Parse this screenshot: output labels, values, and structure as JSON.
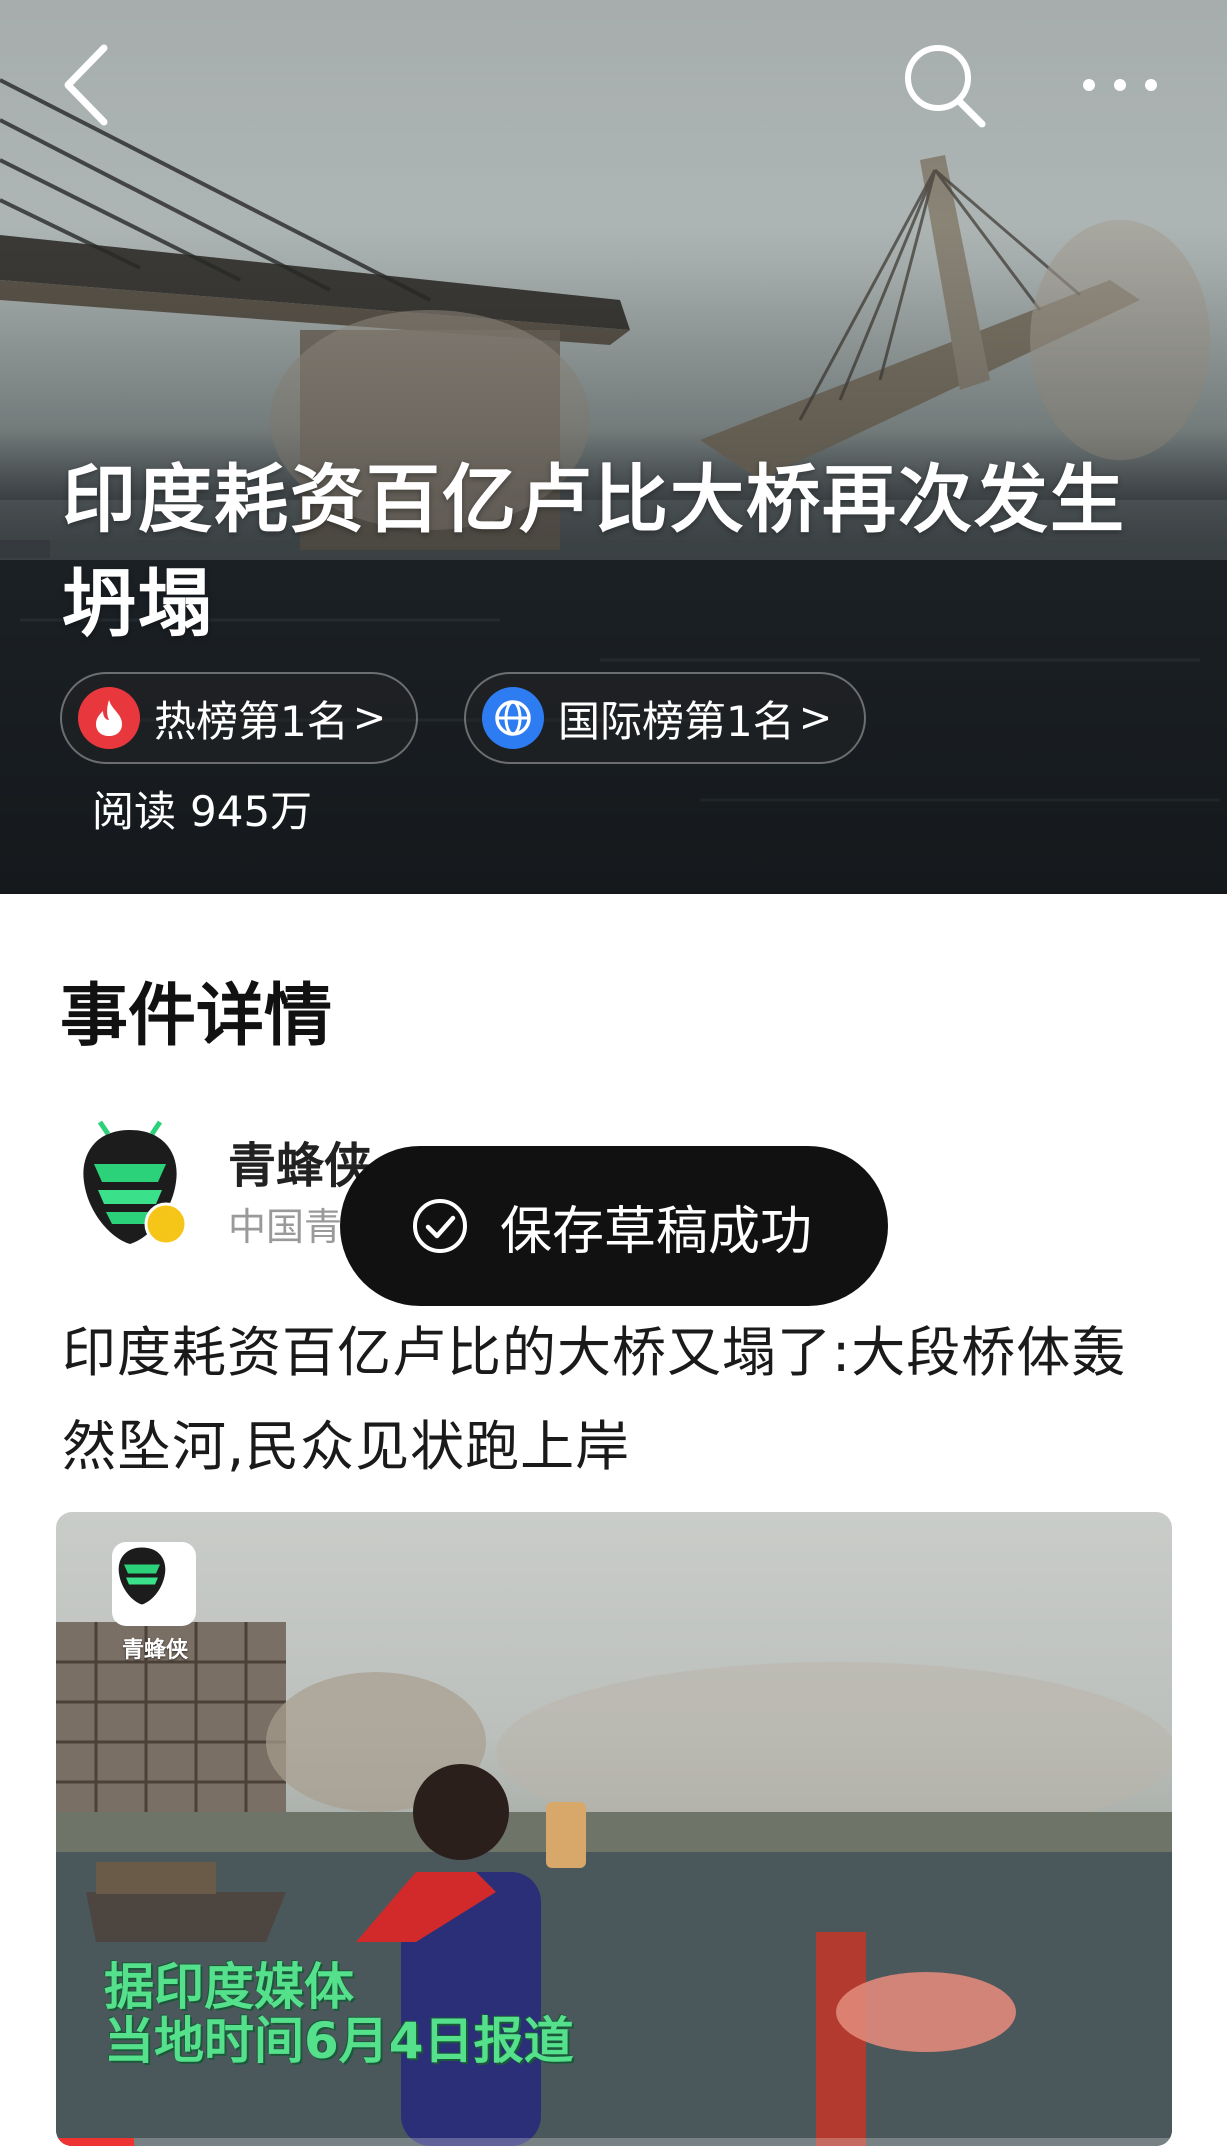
{
  "header": {
    "back_icon": "chevron-left-icon",
    "search_icon": "search-icon",
    "more_icon": "more-horizontal-icon"
  },
  "hero": {
    "title": "印度耗资百亿卢比大桥再次发生坍塌",
    "badges": [
      {
        "icon": "fire-icon",
        "label": "热榜第1名",
        "arrow": ">",
        "color": "#e8383d"
      },
      {
        "icon": "globe-icon",
        "label": "国际榜第1名",
        "arrow": ">",
        "color": "#2d7cf2"
      }
    ],
    "read_label": "阅读",
    "read_count": "945万"
  },
  "section": {
    "title": "事件详情"
  },
  "post": {
    "author_name": "青蜂侠",
    "author_sub": "中国青年网视频",
    "verified": "V",
    "text": "印度耗资百亿卢比的大桥又塌了:大段桥体轰然坠河,民众见状跑上岸",
    "video": {
      "watermark": "青蜂侠",
      "caption_line1": "据印度媒体",
      "caption_line2": "当地时间6月4日报道",
      "progress": 0.07
    }
  },
  "toast": {
    "text": "保存草稿成功",
    "icon": "check-circle-icon"
  },
  "colors": {
    "hot": "#e8383d",
    "intl": "#2d7cf2",
    "caption": "#55e08c",
    "toast_bg": "#111111"
  }
}
